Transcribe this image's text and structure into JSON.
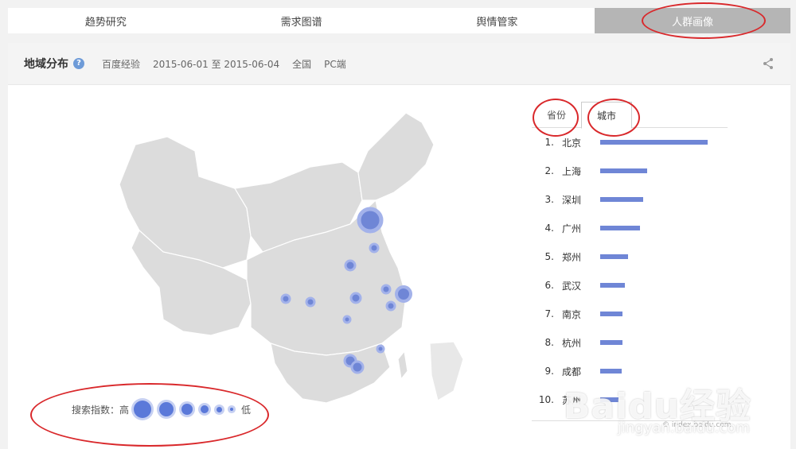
{
  "nav": {
    "tabs": [
      {
        "label": "趋势研究",
        "active": false
      },
      {
        "label": "需求图谱",
        "active": false
      },
      {
        "label": "舆情管家",
        "active": false
      },
      {
        "label": "人群画像",
        "active": true
      }
    ]
  },
  "panel": {
    "title": "地域分布",
    "help": "?",
    "source": "百度经验",
    "date_range": "2015-06-01 至 2015-06-04",
    "region": "全国",
    "device": "PC端"
  },
  "legend": {
    "label": "搜索指数：高",
    "low": "低"
  },
  "region_tabs": [
    {
      "label": "省份",
      "active": false
    },
    {
      "label": "城市",
      "active": true
    }
  ],
  "ranking": [
    {
      "rank": "1.",
      "city": "北京",
      "value": 100
    },
    {
      "rank": "2.",
      "city": "上海",
      "value": 44
    },
    {
      "rank": "3.",
      "city": "深圳",
      "value": 40
    },
    {
      "rank": "4.",
      "city": "广州",
      "value": 37
    },
    {
      "rank": "5.",
      "city": "郑州",
      "value": 26
    },
    {
      "rank": "6.",
      "city": "武汉",
      "value": 23
    },
    {
      "rank": "7.",
      "city": "南京",
      "value": 21
    },
    {
      "rank": "8.",
      "city": "杭州",
      "value": 21
    },
    {
      "rank": "9.",
      "city": "成都",
      "value": 20
    },
    {
      "rank": "10.",
      "city": "苏州",
      "value": 17
    }
  ],
  "copyright": "© index.baidu.com",
  "watermark": {
    "main": "Baidu经验",
    "sub": "jingyan.baidu.com"
  },
  "colors": {
    "bar": "#6f86d6",
    "bubble": "#5b79d9",
    "map": "#dcdcdc",
    "annotation": "#d9282b"
  }
}
